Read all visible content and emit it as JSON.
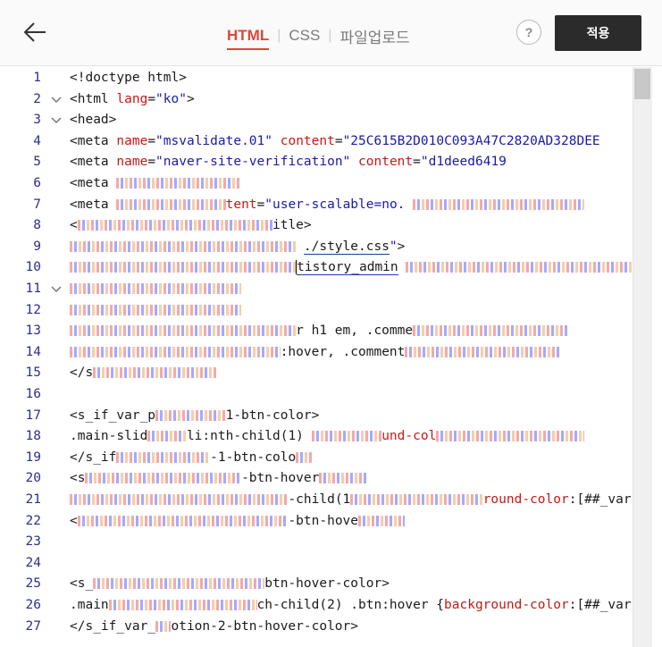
{
  "topbar": {
    "back_icon": "arrow-left-icon",
    "tabs": [
      {
        "label": "HTML",
        "active": true
      },
      {
        "label": "CSS",
        "active": false
      },
      {
        "label": "파일업로드",
        "active": false
      }
    ],
    "separator": "|",
    "help_label": "?",
    "apply_label": "적용"
  },
  "colors": {
    "accent": "#e0463a",
    "apply_bg": "#2b2b2b",
    "line_number": "#2e2e8a",
    "attr": "#c41a16",
    "string": "#1a1aa6"
  },
  "editor": {
    "lines": [
      {
        "n": "1",
        "fold": false,
        "segs": [
          {
            "t": "tag",
            "v": "<!doctype html>"
          }
        ]
      },
      {
        "n": "2",
        "fold": true,
        "segs": [
          {
            "t": "tag",
            "v": "<html "
          },
          {
            "t": "attr",
            "v": "lang"
          },
          {
            "t": "tag",
            "v": "="
          },
          {
            "t": "str",
            "v": "\"ko\""
          },
          {
            "t": "tag",
            "v": ">"
          }
        ]
      },
      {
        "n": "3",
        "fold": true,
        "segs": [
          {
            "t": "tag",
            "v": "<head>"
          }
        ]
      },
      {
        "n": "4",
        "fold": false,
        "segs": [
          {
            "t": "tag",
            "v": "<meta "
          },
          {
            "t": "attr",
            "v": "name"
          },
          {
            "t": "tag",
            "v": "="
          },
          {
            "t": "str",
            "v": "\"msvalidate.01\""
          },
          {
            "t": "tag",
            "v": " "
          },
          {
            "t": "attr",
            "v": "content"
          },
          {
            "t": "tag",
            "v": "="
          },
          {
            "t": "str",
            "v": "\"25C615B2D010C093A47C2820AD328DEE"
          }
        ]
      },
      {
        "n": "5",
        "fold": false,
        "segs": [
          {
            "t": "tag",
            "v": "<meta "
          },
          {
            "t": "attr",
            "v": "name"
          },
          {
            "t": "tag",
            "v": "="
          },
          {
            "t": "str",
            "v": "\"naver-site-verification\""
          },
          {
            "t": "tag",
            "v": " "
          },
          {
            "t": "attr",
            "v": "content"
          },
          {
            "t": "tag",
            "v": "="
          },
          {
            "t": "str",
            "v": "\"d1deed6419"
          }
        ]
      },
      {
        "n": "6",
        "fold": false,
        "segs": [
          {
            "t": "tag",
            "v": "<meta "
          },
          {
            "t": "redact",
            "v": "16"
          }
        ]
      },
      {
        "n": "7",
        "fold": false,
        "segs": [
          {
            "t": "tag",
            "v": "<meta "
          },
          {
            "t": "redact",
            "v": "14"
          },
          {
            "t": "attr",
            "v": "tent"
          },
          {
            "t": "tag",
            "v": "="
          },
          {
            "t": "str",
            "v": "\"user-scalable=no. "
          },
          {
            "t": "redact",
            "v": "22"
          }
        ]
      },
      {
        "n": "8",
        "fold": false,
        "segs": [
          {
            "t": "tag",
            "v": "<"
          },
          {
            "t": "redact",
            "v": "25"
          },
          {
            "t": "tag",
            "v": "itle>"
          }
        ]
      },
      {
        "n": "9",
        "fold": false,
        "segs": [
          {
            "t": "redact",
            "v": "29"
          },
          {
            "t": "tag",
            "v": " "
          },
          {
            "t": "link",
            "v": "./style.css"
          },
          {
            "t": "str",
            "v": "\""
          },
          {
            "t": "tag",
            "v": ">"
          }
        ]
      },
      {
        "n": "10",
        "fold": false,
        "segs": [
          {
            "t": "redact",
            "v": "29"
          },
          {
            "t": "cursor",
            "v": ""
          },
          {
            "t": "link",
            "v": "tistory_admin"
          },
          {
            "t": "tag",
            "v": " "
          },
          {
            "t": "redact",
            "v": "30"
          }
        ]
      },
      {
        "n": "11",
        "fold": true,
        "segs": [
          {
            "t": "redact",
            "v": "22"
          }
        ]
      },
      {
        "n": "12",
        "fold": false,
        "segs": [
          {
            "t": "redact",
            "v": "22"
          }
        ]
      },
      {
        "n": "13",
        "fold": false,
        "segs": [
          {
            "t": "redact",
            "v": "29"
          },
          {
            "t": "tag",
            "v": "r h1 em, .comme"
          },
          {
            "t": "redact",
            "v": "20"
          }
        ]
      },
      {
        "n": "14",
        "fold": false,
        "segs": [
          {
            "t": "redact",
            "v": "27"
          },
          {
            "t": "tag",
            "v": ":hover, .comment"
          },
          {
            "t": "redact",
            "v": "20"
          }
        ]
      },
      {
        "n": "15",
        "fold": false,
        "segs": [
          {
            "t": "tag",
            "v": "</s"
          },
          {
            "t": "redact",
            "v": "16"
          }
        ]
      },
      {
        "n": "16",
        "fold": false,
        "segs": []
      },
      {
        "n": "17",
        "fold": false,
        "segs": [
          {
            "t": "tag",
            "v": "<s_if_var_p"
          },
          {
            "t": "redact",
            "v": "9"
          },
          {
            "t": "tag",
            "v": "1-btn-color>"
          }
        ]
      },
      {
        "n": "18",
        "fold": false,
        "segs": [
          {
            "t": "tag",
            "v": ".main-slid"
          },
          {
            "t": "redact",
            "v": "5"
          },
          {
            "t": "tag",
            "v": "li:nth-child(1) "
          },
          {
            "t": "redact",
            "v": "9"
          },
          {
            "t": "prop",
            "v": "und-col"
          },
          {
            "t": "redact",
            "v": "19"
          }
        ]
      },
      {
        "n": "19",
        "fold": false,
        "segs": [
          {
            "t": "tag",
            "v": "</s_if"
          },
          {
            "t": "redact",
            "v": "12"
          },
          {
            "t": "tag",
            "v": "-1-btn-colo"
          },
          {
            "t": "redact",
            "v": "2"
          }
        ]
      },
      {
        "n": "20",
        "fold": false,
        "segs": [
          {
            "t": "tag",
            "v": "<s"
          },
          {
            "t": "redact",
            "v": "20"
          },
          {
            "t": "tag",
            "v": "-btn-hover"
          },
          {
            "t": "redact",
            "v": "6"
          }
        ]
      },
      {
        "n": "21",
        "fold": false,
        "segs": [
          {
            "t": "redact",
            "v": "28"
          },
          {
            "t": "tag",
            "v": "-child(1"
          },
          {
            "t": "redact",
            "v": "17"
          },
          {
            "t": "prop",
            "v": "round-color"
          },
          {
            "t": "tag",
            "v": ":[##_var"
          }
        ]
      },
      {
        "n": "22",
        "fold": false,
        "segs": [
          {
            "t": "tag",
            "v": "<"
          },
          {
            "t": "redact",
            "v": "27"
          },
          {
            "t": "tag",
            "v": "-btn-hove"
          },
          {
            "t": "redact",
            "v": "6"
          }
        ]
      },
      {
        "n": "23",
        "fold": false,
        "segs": []
      },
      {
        "n": "24",
        "fold": false,
        "segs": []
      },
      {
        "n": "25",
        "fold": false,
        "segs": [
          {
            "t": "tag",
            "v": "<s_"
          },
          {
            "t": "redact",
            "v": "22"
          },
          {
            "t": "tag",
            "v": "btn-hover-color>"
          }
        ]
      },
      {
        "n": "26",
        "fold": false,
        "segs": [
          {
            "t": "tag",
            "v": ".main"
          },
          {
            "t": "redact",
            "v": "19"
          },
          {
            "t": "tag",
            "v": "ch-child(2) .btn:hover {"
          },
          {
            "t": "prop",
            "v": "background-color"
          },
          {
            "t": "tag",
            "v": ":[##_var"
          }
        ]
      },
      {
        "n": "27",
        "fold": false,
        "segs": [
          {
            "t": "tag",
            "v": "</s_if_var_"
          },
          {
            "t": "redact",
            "v": "2"
          },
          {
            "t": "tag",
            "v": "otion-2-btn-hover-color>"
          }
        ]
      }
    ]
  }
}
